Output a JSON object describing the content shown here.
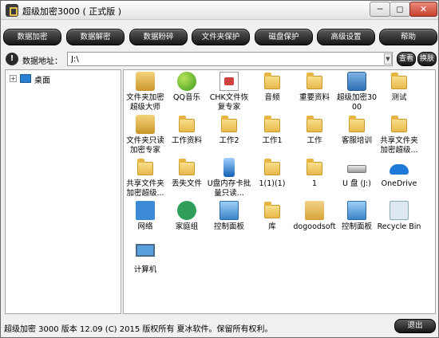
{
  "window": {
    "title": "超级加密3000 ( 正式版 )",
    "minimize": "─",
    "maximize": "◻",
    "close": "✕"
  },
  "toolbar": {
    "buttons": [
      "数据加密",
      "数据解密",
      "数据粉碎",
      "文件夹保护",
      "磁盘保护",
      "高级设置",
      "帮助"
    ]
  },
  "address": {
    "label": "数据地址：",
    "value": "J:\\",
    "view_button": "查看",
    "switch_button": "换肤"
  },
  "tree": {
    "items": [
      {
        "label": "桌面",
        "expander": "+"
      }
    ]
  },
  "files": {
    "items": [
      {
        "label": "文件夹加密超级大师",
        "icon": "lock-folder-icon"
      },
      {
        "label": "QQ音乐",
        "icon": "qq-music-icon"
      },
      {
        "label": "CHK文件恢复专家",
        "icon": "chk-file-icon"
      },
      {
        "label": "音频",
        "icon": "folder-icon"
      },
      {
        "label": "重要资料",
        "icon": "folder-icon"
      },
      {
        "label": "超级加密3000",
        "icon": "cabinet-icon"
      },
      {
        "label": "测试",
        "icon": "folder-icon"
      },
      {
        "label": "文件夹只读加密专家",
        "icon": "lock-folder-icon"
      },
      {
        "label": "工作资料",
        "icon": "folder-icon"
      },
      {
        "label": "工作2",
        "icon": "folder-icon"
      },
      {
        "label": "工作1",
        "icon": "folder-icon"
      },
      {
        "label": "工作",
        "icon": "folder-icon"
      },
      {
        "label": "客服培训",
        "icon": "folder-icon"
      },
      {
        "label": "共享文件夹加密超级...",
        "icon": "share-folder-icon"
      },
      {
        "label": "共享文件夹加密超级...",
        "icon": "folder-icon"
      },
      {
        "label": "丢失文件",
        "icon": "folder-icon"
      },
      {
        "label": "U盘内存卡批量只读...",
        "icon": "usb-icon"
      },
      {
        "label": "1(1)(1)",
        "icon": "folder-icon"
      },
      {
        "label": "1",
        "icon": "folder-icon"
      },
      {
        "label": "U 盘 (J:)",
        "icon": "drive-icon"
      },
      {
        "label": "OneDrive",
        "icon": "onedrive-icon"
      },
      {
        "label": "网络",
        "icon": "network-icon"
      },
      {
        "label": "家庭组",
        "icon": "homegroup-icon"
      },
      {
        "label": "控制面板",
        "icon": "control-panel-icon"
      },
      {
        "label": "库",
        "icon": "library-icon"
      },
      {
        "label": "dogoodsoft",
        "icon": "user-folder-icon"
      },
      {
        "label": "控制面板",
        "icon": "control-panel-icon"
      },
      {
        "label": "Recycle Bin",
        "icon": "recycle-bin-icon"
      },
      {
        "label": "计算机",
        "icon": "computer-icon"
      }
    ]
  },
  "status": {
    "text": "超级加密 3000 版本 12.09 (C) 2015 版权所有 夏冰软件。保留所有权利。",
    "exit_button": "退出"
  }
}
